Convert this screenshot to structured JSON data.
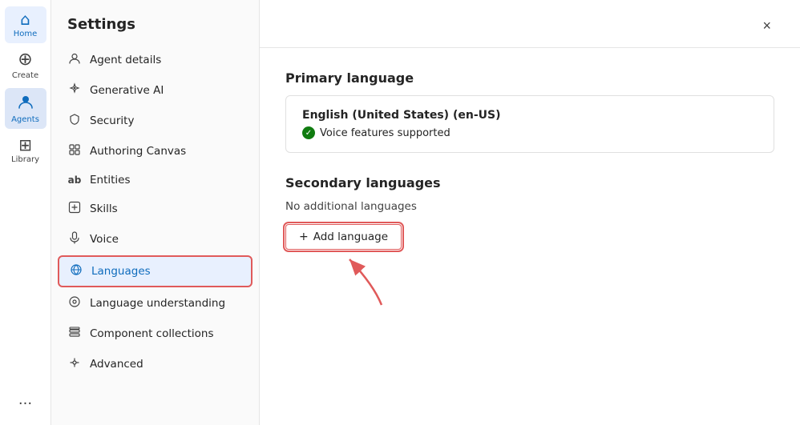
{
  "nav": {
    "items": [
      {
        "id": "home",
        "label": "Home",
        "icon": "⌂",
        "active": false
      },
      {
        "id": "create",
        "label": "Create",
        "icon": "+",
        "active": false
      },
      {
        "id": "agents",
        "label": "Agents",
        "icon": "◉",
        "active": true
      },
      {
        "id": "library",
        "label": "Library",
        "icon": "⊞",
        "active": false
      }
    ],
    "more_icon": "···"
  },
  "settings": {
    "title": "Settings",
    "close_label": "×",
    "menu_items": [
      {
        "id": "agent-details",
        "label": "Agent details",
        "icon": "◎",
        "active": false
      },
      {
        "id": "generative-ai",
        "label": "Generative AI",
        "icon": "✦",
        "active": false
      },
      {
        "id": "security",
        "label": "Security",
        "icon": "⊕",
        "active": false
      },
      {
        "id": "authoring-canvas",
        "label": "Authoring Canvas",
        "icon": "⊞",
        "active": false
      },
      {
        "id": "entities",
        "label": "Entities",
        "icon": "ab",
        "active": false
      },
      {
        "id": "skills",
        "label": "Skills",
        "icon": "⊡",
        "active": false
      },
      {
        "id": "voice",
        "label": "Voice",
        "icon": "◎",
        "active": false
      },
      {
        "id": "languages",
        "label": "Languages",
        "icon": "◈",
        "active": true
      },
      {
        "id": "language-understanding",
        "label": "Language understanding",
        "icon": "⊙",
        "active": false
      },
      {
        "id": "component-collections",
        "label": "Component collections",
        "icon": "⊟",
        "active": false
      },
      {
        "id": "advanced",
        "label": "Advanced",
        "icon": "⇌",
        "active": false
      }
    ]
  },
  "main": {
    "primary_language_title": "Primary language",
    "primary_language_name": "English (United States) (en-US)",
    "voice_supported_label": "Voice features supported",
    "secondary_languages_title": "Secondary languages",
    "no_additional_label": "No additional languages",
    "add_language_label": "Add language",
    "plus_symbol": "+"
  }
}
